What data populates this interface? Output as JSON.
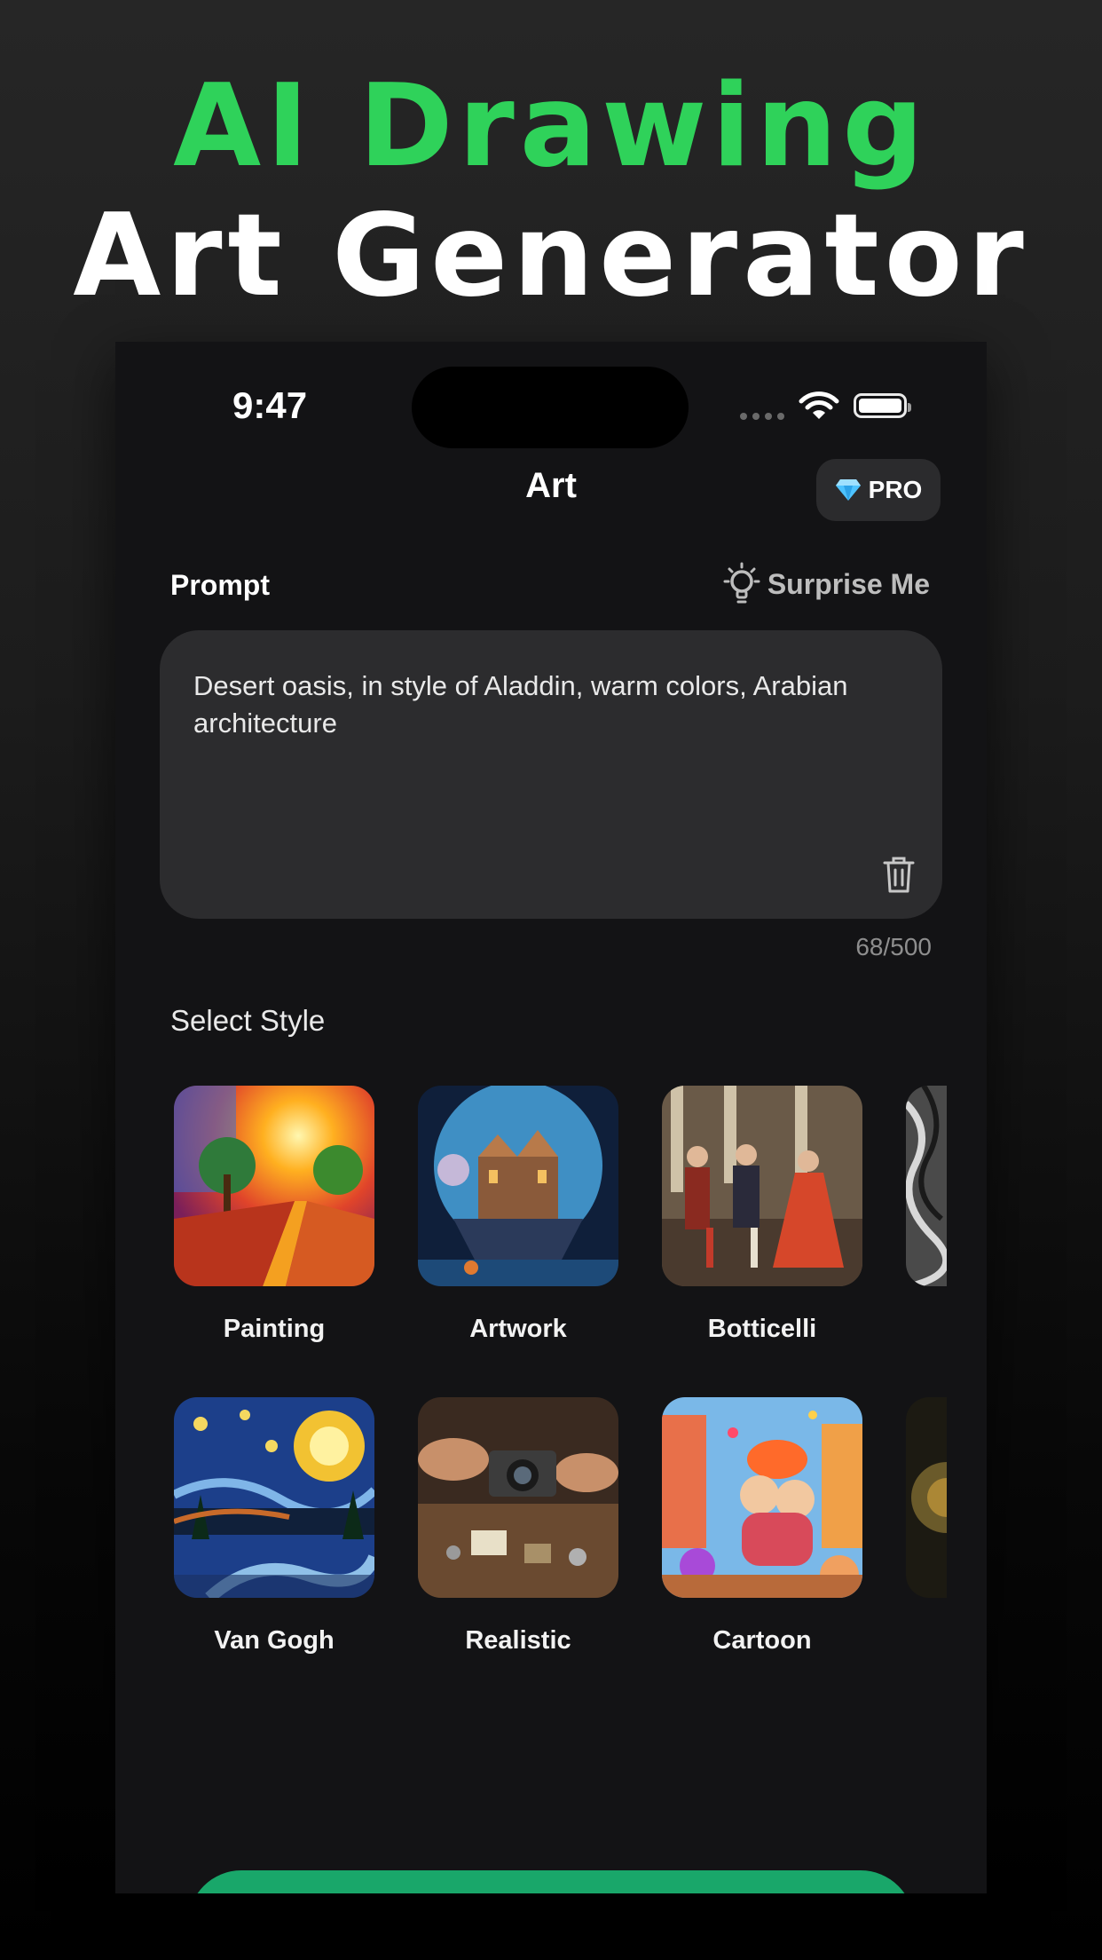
{
  "promo": {
    "line1": "AI Drawing",
    "line2": "Art Generator"
  },
  "status_bar": {
    "time": "9:47"
  },
  "nav": {
    "title": "Art",
    "pro_label": "PRO"
  },
  "prompt": {
    "label": "Prompt",
    "surprise_label": "Surprise Me",
    "text": "Desert oasis, in style of Aladdin, warm colors, Arabian architecture",
    "counter": "68/500"
  },
  "styles": {
    "label": "Select Style",
    "items": [
      {
        "label": "Painting"
      },
      {
        "label": "Artwork"
      },
      {
        "label": "Botticelli"
      },
      {
        "label": "Van Gogh"
      },
      {
        "label": "Realistic"
      },
      {
        "label": "Cartoon"
      }
    ]
  },
  "colors": {
    "accent": "#2fd25a",
    "cta": "#19a76a",
    "background": "#131315",
    "field": "#2c2c2e"
  }
}
